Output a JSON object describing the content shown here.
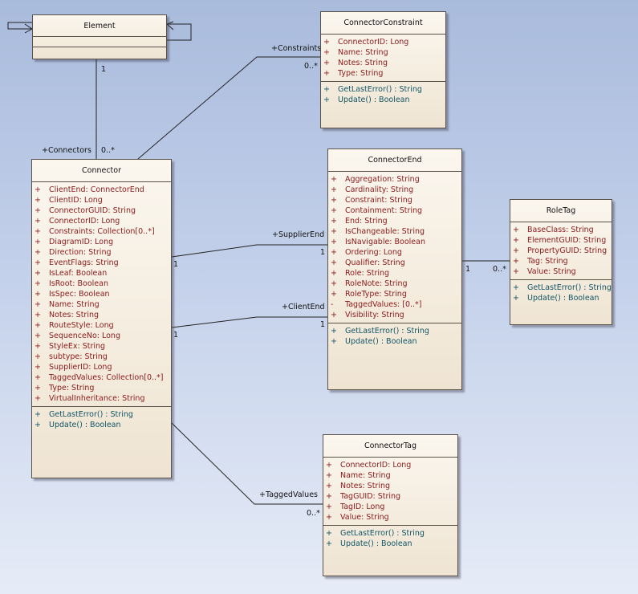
{
  "classes": {
    "element": {
      "name": "Element"
    },
    "constraint": {
      "name": "ConnectorConstraint",
      "attributes": [
        {
          "vis": "+",
          "text": "ConnectorID:  Long"
        },
        {
          "vis": "+",
          "text": "Name:  String"
        },
        {
          "vis": "+",
          "text": "Notes:  String"
        },
        {
          "vis": "+",
          "text": "Type:  String"
        }
      ],
      "operations": [
        {
          "vis": "+",
          "text": "GetLastError() : String"
        },
        {
          "vis": "+",
          "text": "Update() : Boolean"
        }
      ]
    },
    "connector": {
      "name": "Connector",
      "attributes": [
        {
          "vis": "+",
          "text": "ClientEnd:  ConnectorEnd"
        },
        {
          "vis": "+",
          "text": "ClientID:  Long"
        },
        {
          "vis": "+",
          "text": "ConnectorGUID:  String"
        },
        {
          "vis": "+",
          "text": "ConnectorID:  Long"
        },
        {
          "vis": "+",
          "text": "Constraints:  Collection[0..*]"
        },
        {
          "vis": "+",
          "text": "DiagramID:  Long"
        },
        {
          "vis": "+",
          "text": "Direction:  String"
        },
        {
          "vis": "+",
          "text": "EventFlags:  String"
        },
        {
          "vis": "+",
          "text": "IsLeaf:  Boolean"
        },
        {
          "vis": "+",
          "text": "IsRoot:  Boolean"
        },
        {
          "vis": "+",
          "text": "IsSpec:  Boolean"
        },
        {
          "vis": "+",
          "text": "Name:  String"
        },
        {
          "vis": "+",
          "text": "Notes:  String"
        },
        {
          "vis": "+",
          "text": "RouteStyle:  Long"
        },
        {
          "vis": "+",
          "text": "SequenceNo:  Long"
        },
        {
          "vis": "+",
          "text": "StyleEx:  String"
        },
        {
          "vis": "+",
          "text": "subtype:  String"
        },
        {
          "vis": "+",
          "text": "SupplierID:  Long"
        },
        {
          "vis": "+",
          "text": "TaggedValues:  Collection[0..*]"
        },
        {
          "vis": "+",
          "text": "Type:  String"
        },
        {
          "vis": "+",
          "text": "VirtualInheritance:  String"
        }
      ],
      "operations": [
        {
          "vis": "+",
          "text": "GetLastError() : String"
        },
        {
          "vis": "+",
          "text": "Update() : Boolean"
        }
      ]
    },
    "end": {
      "name": "ConnectorEnd",
      "attributes": [
        {
          "vis": "+",
          "text": "Aggregation:  String"
        },
        {
          "vis": "+",
          "text": "Cardinality:  String"
        },
        {
          "vis": "+",
          "text": "Constraint:  String"
        },
        {
          "vis": "+",
          "text": "Containment:  String"
        },
        {
          "vis": "+",
          "text": "End:  String"
        },
        {
          "vis": "+",
          "text": "IsChangeable:  String"
        },
        {
          "vis": "+",
          "text": "IsNavigable:  Boolean"
        },
        {
          "vis": "+",
          "text": "Ordering:  Long"
        },
        {
          "vis": "+",
          "text": "Qualifier:  String"
        },
        {
          "vis": "+",
          "text": "Role:  String"
        },
        {
          "vis": "+",
          "text": "RoleNote:  String"
        },
        {
          "vis": "+",
          "text": "RoleType:  String"
        },
        {
          "vis": "-",
          "text": "TaggedValues:    [0..*]"
        },
        {
          "vis": "+",
          "text": "Visibility:  String"
        }
      ],
      "operations": [
        {
          "vis": "+",
          "text": "GetLastError() : String"
        },
        {
          "vis": "+",
          "text": "Update() : Boolean"
        }
      ]
    },
    "roletag": {
      "name": "RoleTag",
      "attributes": [
        {
          "vis": "+",
          "text": "BaseClass:  String"
        },
        {
          "vis": "+",
          "text": "ElementGUID:  String"
        },
        {
          "vis": "+",
          "text": "PropertyGUID:  String"
        },
        {
          "vis": "+",
          "text": "Tag:  String"
        },
        {
          "vis": "+",
          "text": "Value:  String"
        }
      ],
      "operations": [
        {
          "vis": "+",
          "text": "GetLastError() : String"
        },
        {
          "vis": "+",
          "text": "Update() : Boolean"
        }
      ]
    },
    "tag": {
      "name": "ConnectorTag",
      "attributes": [
        {
          "vis": "+",
          "text": "ConnectorID:  Long"
        },
        {
          "vis": "+",
          "text": "Name:  String"
        },
        {
          "vis": "+",
          "text": "Notes:  String"
        },
        {
          "vis": "+",
          "text": "TagGUID:  String"
        },
        {
          "vis": "+",
          "text": "TagID:  Long"
        },
        {
          "vis": "+",
          "text": "Value:  String"
        }
      ],
      "operations": [
        {
          "vis": "+",
          "text": "GetLastError() : String"
        },
        {
          "vis": "+",
          "text": "Update() : Boolean"
        }
      ]
    }
  },
  "associations": {
    "element_connector": {
      "element_mult": "1",
      "connector_role": "+Connectors",
      "connector_mult": "0..*"
    },
    "constraints": {
      "role": "+Constraints",
      "mult": "0..*"
    },
    "supplier_end": {
      "source_mult": "1",
      "role": "+SupplierEnd",
      "target_mult": "1"
    },
    "client_end": {
      "source_mult": "1",
      "role": "+ClientEnd",
      "target_mult": "1"
    },
    "roletag": {
      "source_mult": "1",
      "target_mult": "0..*"
    },
    "tagged_values": {
      "role": "+TaggedValues",
      "mult": "0..*"
    }
  },
  "colors": {
    "attribute": "#8b1a1a",
    "operation": "#115566",
    "line": "#222222",
    "class_fill": "#efe4d2"
  }
}
